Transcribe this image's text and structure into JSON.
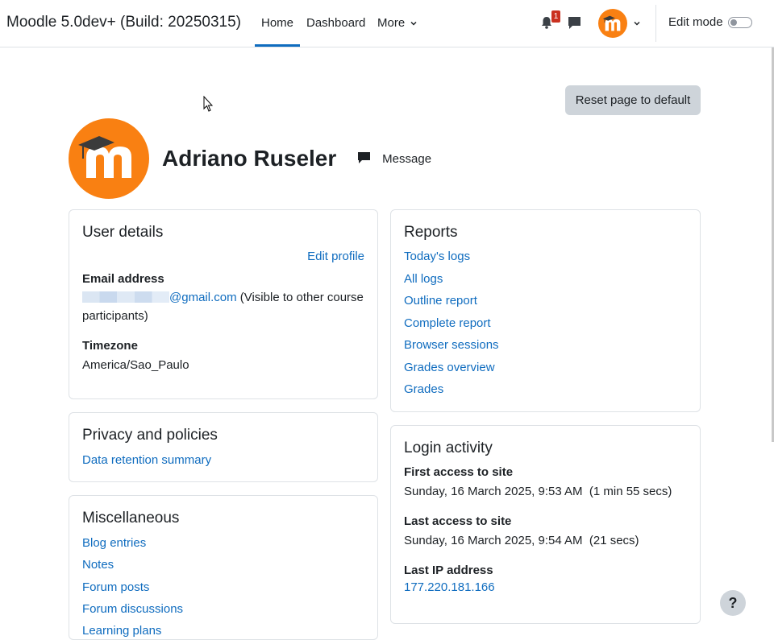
{
  "navbar": {
    "brand": "Moodle 5.0dev+ (Build: 20250315)",
    "items": [
      {
        "label": "Home"
      },
      {
        "label": "Dashboard"
      },
      {
        "label": "More"
      }
    ],
    "notification_count": "1",
    "edit_mode_label": "Edit mode"
  },
  "page": {
    "reset_button": "Reset page to default",
    "user_name": "Adriano Ruseler",
    "message_label": "Message"
  },
  "user_details": {
    "title": "User details",
    "edit_profile": "Edit profile",
    "email_label": "Email address",
    "email_domain": "@gmail.com",
    "email_note_1": " (Visible to other course",
    "email_note_2": "participants)",
    "timezone_label": "Timezone",
    "timezone_value": "America/Sao_Paulo"
  },
  "privacy": {
    "title": "Privacy and policies",
    "links": [
      "Data retention summary"
    ]
  },
  "misc": {
    "title": "Miscellaneous",
    "links": [
      "Blog entries",
      "Notes",
      "Forum posts",
      "Forum discussions",
      "Learning plans"
    ]
  },
  "reports": {
    "title": "Reports",
    "links": [
      "Today's logs",
      "All logs",
      "Outline report",
      "Complete report",
      "Browser sessions",
      "Grades overview",
      "Grades"
    ]
  },
  "login_activity": {
    "title": "Login activity",
    "first_access_label": "First access to site",
    "first_access_value": "Sunday, 16 March 2025, 9:53 AM  (1 min 55 secs)",
    "last_access_label": "Last access to site",
    "last_access_value": "Sunday, 16 March 2025, 9:54 AM  (21 secs)",
    "last_ip_label": "Last IP address",
    "last_ip_value": "177.220.181.166"
  },
  "help": {
    "label": "?"
  },
  "colors": {
    "brand_orange": "#f98012",
    "link_blue": "#0f6cbf",
    "badge_red": "#ca3120"
  }
}
